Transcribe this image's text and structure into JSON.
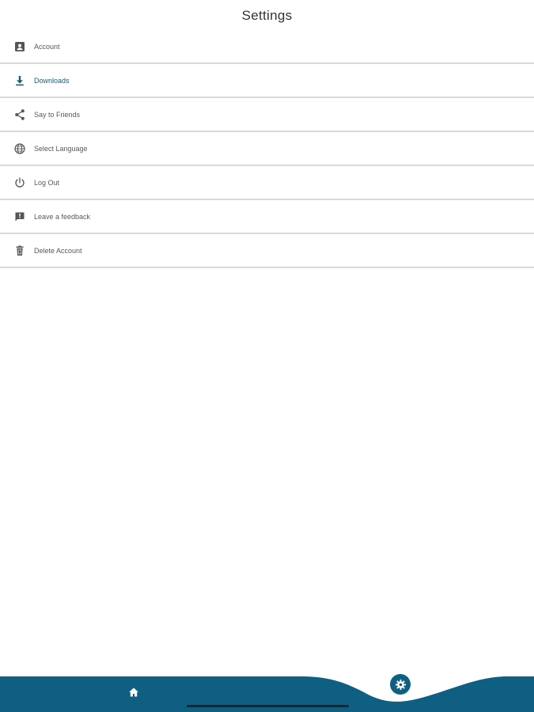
{
  "header": {
    "title": "Settings"
  },
  "menu": {
    "items": [
      {
        "label": "Account",
        "icon": "account-box-icon"
      },
      {
        "label": "Downloads",
        "icon": "download-icon"
      },
      {
        "label": "Say to Friends",
        "icon": "share-icon"
      },
      {
        "label": "Select Language",
        "icon": "globe-icon"
      },
      {
        "label": "Log Out",
        "icon": "power-icon"
      },
      {
        "label": "Leave a feedback",
        "icon": "feedback-icon"
      },
      {
        "label": "Delete Account",
        "icon": "trash-icon"
      }
    ]
  },
  "bottom_nav": {
    "items": [
      {
        "icon": "home-icon"
      },
      {
        "icon": "gear-icon",
        "active": true
      }
    ]
  },
  "colors": {
    "accent": "#0e5f81",
    "active_text": "#1e5b78",
    "divider": "#d9d9d9",
    "icon": "#555555"
  }
}
